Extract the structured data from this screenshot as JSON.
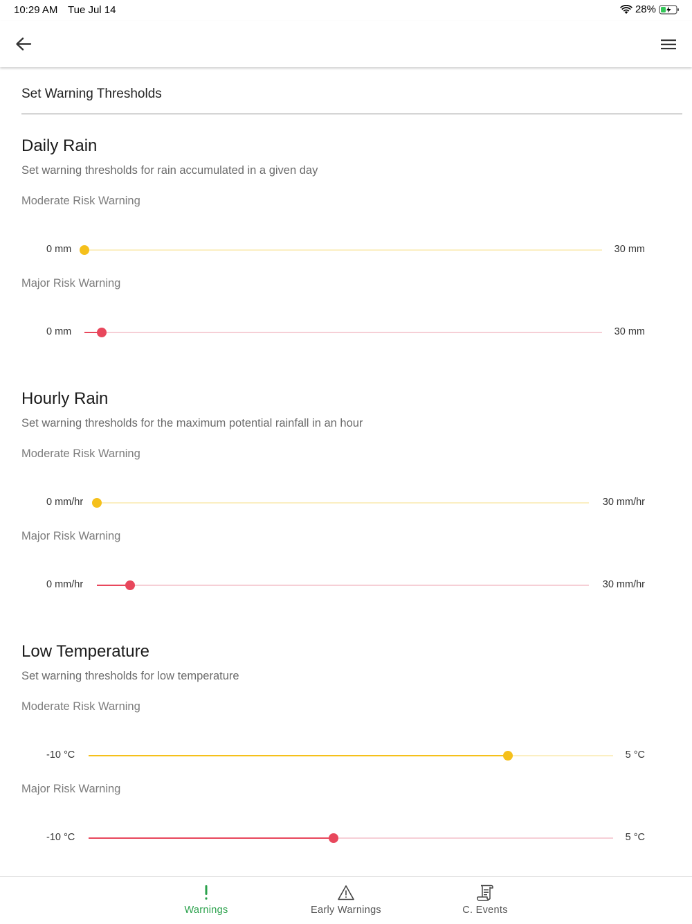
{
  "status": {
    "time": "10:29 AM",
    "date": "Tue Jul 14",
    "battery": "28%"
  },
  "app_bar": {
    "back_icon": "arrow-left-icon",
    "menu_icon": "hamburger-menu-icon"
  },
  "page": {
    "heading": "Set Warning Thresholds"
  },
  "sections": [
    {
      "title": "Daily Rain",
      "description": "Set warning thresholds for rain accumulated in a given day",
      "moderate": {
        "label": "Moderate Risk Warning",
        "min": "0 mm",
        "max": "30 mm",
        "value_fraction": 0.0
      },
      "major": {
        "label": "Major Risk Warning",
        "min": "0 mm",
        "max": "30 mm",
        "value_fraction": 0.033
      }
    },
    {
      "title": "Hourly Rain",
      "description": "Set warning thresholds for the maximum potential rainfall in an hour",
      "moderate": {
        "label": "Moderate Risk Warning",
        "min": "0 mm/hr",
        "max": "30 mm/hr",
        "value_fraction": 0.0
      },
      "major": {
        "label": "Major Risk Warning",
        "min": "0 mm/hr",
        "max": "30 mm/hr",
        "value_fraction": 0.067
      }
    },
    {
      "title": "Low Temperature",
      "description": "Set warning thresholds for low temperature",
      "moderate": {
        "label": "Moderate Risk Warning",
        "min": "-10 °C",
        "max": "5 °C",
        "value_fraction": 0.8
      },
      "major": {
        "label": "Major Risk Warning",
        "min": "-10 °C",
        "max": "5 °C",
        "value_fraction": 0.467
      }
    }
  ],
  "bottom_nav": [
    {
      "label": "Warnings",
      "icon": "exclamation-icon",
      "active": true
    },
    {
      "label": "Early Warnings",
      "icon": "warning-triangle-icon",
      "active": false
    },
    {
      "label": "C. Events",
      "icon": "scroll-document-icon",
      "active": false
    }
  ],
  "colors": {
    "moderate": "#f5c01b",
    "major": "#e8475c",
    "active_nav": "#2aa14b"
  }
}
